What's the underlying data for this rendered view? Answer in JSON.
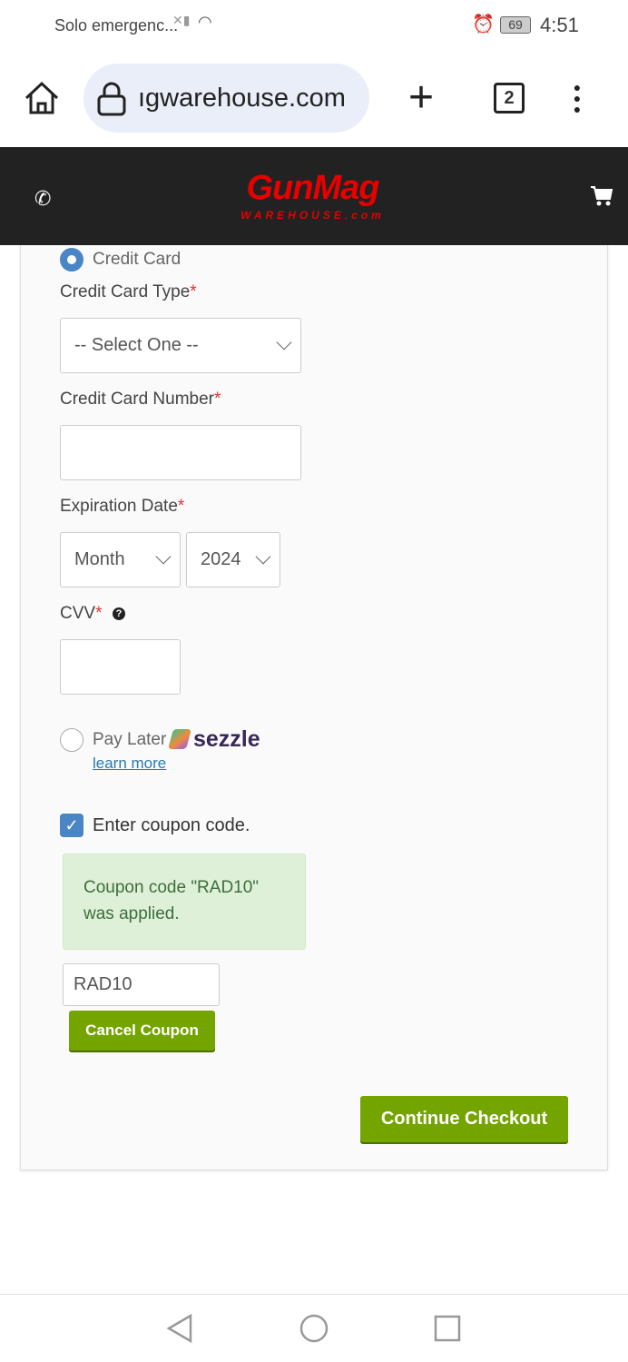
{
  "status_bar": {
    "carrier": "Solo emergenc...",
    "battery": "69",
    "time": "4:51"
  },
  "browser": {
    "url": "ıgwarehouse.com",
    "tab_count": "2"
  },
  "site": {
    "logo_main": "GunMag",
    "logo_sub": "WAREHOUSE.com",
    "brand_color": "#e60000"
  },
  "payment": {
    "credit_card_label": "Credit Card",
    "cc_type_label": "Credit Card Type",
    "cc_type_value": "-- Select One --",
    "cc_number_label": "Credit Card Number",
    "cc_number_value": "",
    "exp_label": "Expiration Date",
    "exp_month": "Month",
    "exp_year": "2024",
    "cvv_label": "CVV",
    "cvv_value": "",
    "required_mark": "*",
    "pay_later_label": "Pay Later",
    "sezzle": "sezzle",
    "learn_more": "learn more",
    "coupon_checkbox_label": "Enter coupon code.",
    "coupon_message": "Coupon code \"RAD10\" was applied.",
    "coupon_value": "RAD10",
    "cancel_coupon": "Cancel Coupon",
    "continue": "Continue Checkout"
  }
}
